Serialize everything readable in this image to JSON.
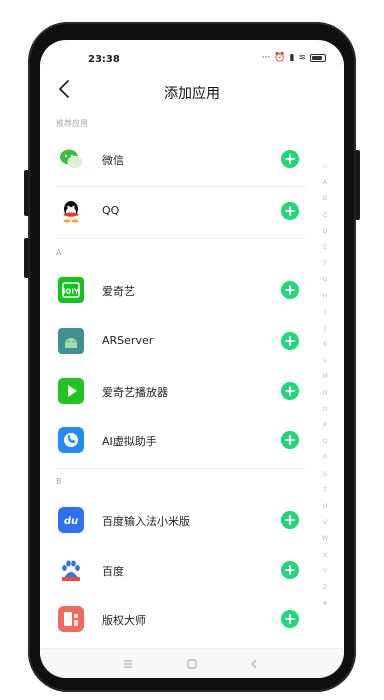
{
  "status_bar": {
    "time": "23:38",
    "icons": [
      "more-icon",
      "alarm-icon",
      "signal-icon",
      "wifi-icon",
      "battery-icon"
    ]
  },
  "header": {
    "title": "添加应用",
    "back_icon": "chevron-left-icon"
  },
  "sections": [
    {
      "label": "推荐应用",
      "apps": [
        {
          "name": "微信",
          "icon": "wechat-icon"
        },
        {
          "name": "QQ",
          "icon": "qq-icon"
        }
      ]
    },
    {
      "label": "A",
      "apps": [
        {
          "name": "爱奇艺",
          "icon": "iqiyi-icon"
        },
        {
          "name": "ARServer",
          "icon": "arserver-icon"
        },
        {
          "name": "爱奇艺播放器",
          "icon": "iqiyi-player-icon"
        },
        {
          "name": "AI虚拟助手",
          "icon": "ai-assistant-icon"
        }
      ]
    },
    {
      "label": "B",
      "apps": [
        {
          "name": "百度输入法小米版",
          "icon": "baidu-input-icon"
        },
        {
          "name": "百度",
          "icon": "baidu-icon"
        },
        {
          "name": "版权大师",
          "icon": "copyright-master-icon"
        }
      ]
    }
  ],
  "index_bar": [
    "☆",
    "A",
    "B",
    "C",
    "D",
    "E",
    "F",
    "G",
    "H",
    "I",
    "J",
    "K",
    "L",
    "M",
    "N",
    "O",
    "P",
    "Q",
    "R",
    "S",
    "T",
    "U",
    "V",
    "W",
    "X",
    "Y",
    "Z",
    "#"
  ],
  "colors": {
    "accent": "#1ed87a",
    "section_label": "#aaaaaa"
  }
}
